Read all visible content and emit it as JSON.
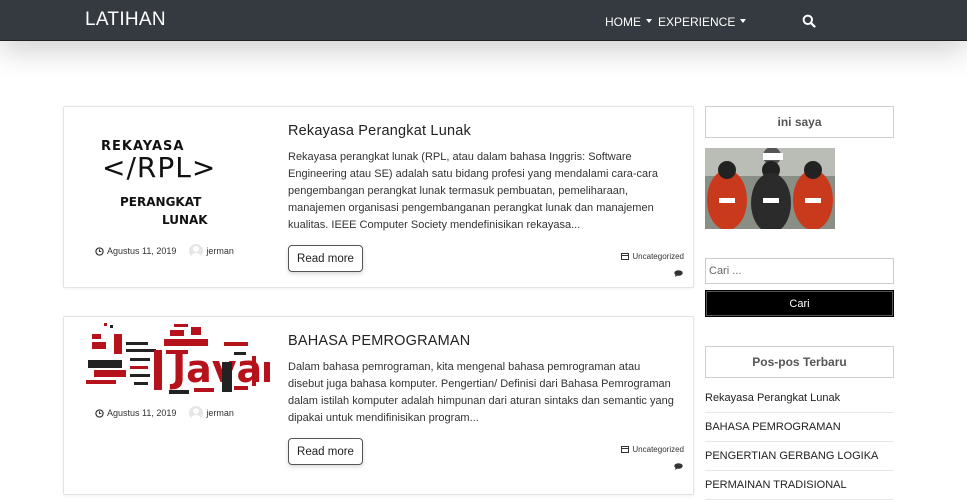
{
  "navbar": {
    "brand": "LATIHAN",
    "items": [
      {
        "label": "HOME"
      },
      {
        "label": "EXPERIENCE"
      }
    ],
    "search_icon": "search-icon"
  },
  "posts": [
    {
      "title": "Rekayasa Perangkat Lunak",
      "excerpt": "Rekayasa perangkat lunak (RPL, atau dalam bahasa Inggris: Software Engineering atau SE) adalah satu bidang profesi yang mendalami cara-cara pengembangan perangkat lunak termasuk pembuatan, pemeliharaan, manajemen organisasi pengembanganan perangkat lunak dan manajemen kualitas. IEEE Computer Society mendefinisikan rekayasa...",
      "date": "Agustus 11, 2019",
      "author": "jerman",
      "read_more": "Read more",
      "category": "Uncategorized",
      "thumb": {
        "line1": "REKAYASA",
        "line2": "</RPL>",
        "line3": "PERANGKAT",
        "line4": "LUNAK"
      }
    },
    {
      "title": "BAHASA PEMROGRAMAN",
      "excerpt": "Dalam bahasa pemrograman, kita mengenal bahasa pemrograman atau disebut juga bahasa komputer. Pengertian/ Definisi dari Bahasa Pemrograman dalam istilah komputer adalah himpunan dari aturan sintaks dan semantic yang dipakai untuk mendifinisikan program...",
      "date": "Agustus 11, 2019",
      "author": "jerman",
      "read_more": "Read more",
      "category": "Uncategorized",
      "thumb": {
        "big": "Java"
      }
    }
  ],
  "sidebar": {
    "profile_title": "ini saya",
    "search_placeholder": "Cari ...",
    "search_button": "Cari",
    "recent_title": "Pos-pos Terbaru",
    "recent": [
      "Rekayasa Perangkat Lunak",
      "BAHASA PEMROGRAMAN",
      "PENGERTIAN GERBANG LOGIKA",
      "PERMAINAN TRADISIONAL"
    ]
  },
  "colors": {
    "navbar_bg": "#343a40",
    "search_button_bg": "#000000",
    "wordcloud_red": "#b5121b"
  }
}
